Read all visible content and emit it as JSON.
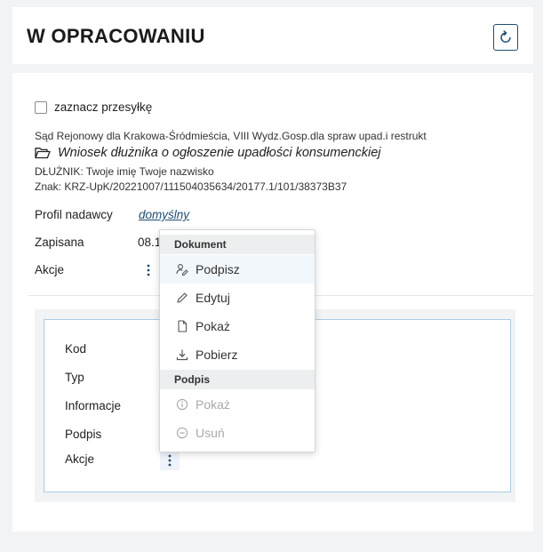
{
  "header": {
    "title": "W OPRACOWANIU"
  },
  "shipment": {
    "select_label": "zaznacz przesyłkę",
    "court": "Sąd Rejonowy dla Krakowa-Śródmieścia, VIII Wydz.Gosp.dla spraw upad.i restrukt",
    "document_title": "Wniosek dłużnika o ogłoszenie upadłości konsumenckiej",
    "debtor": "DŁUŻNIK: Twoje imię Twoje nazwisko",
    "reference": "Znak: KRZ-UpK/20221007/111504035634/20177.1/101/38373B37",
    "fields": {
      "sender_profile_label": "Profil nadawcy",
      "sender_profile_value": "domyślny",
      "saved_label": "Zapisana",
      "saved_value": "08.1",
      "actions_label": "Akcje"
    }
  },
  "document_details": {
    "code_label": "Kod",
    "type_label": "Typ",
    "info_label": "Informacje",
    "signature_label": "Podpis",
    "actions_label": "Akcje"
  },
  "dropdown_menu": {
    "section_document": "Dokument",
    "sign": "Podpisz",
    "edit": "Edytuj",
    "show": "Pokaż",
    "download": "Pobierz",
    "section_signature": "Podpis",
    "signature_show": "Pokaż",
    "signature_remove": "Usuń"
  },
  "colors": {
    "accent": "#1f4d74",
    "panel_border": "#a8cde6",
    "disabled_text": "#a9a9a9",
    "background": "#f2f3f5"
  }
}
